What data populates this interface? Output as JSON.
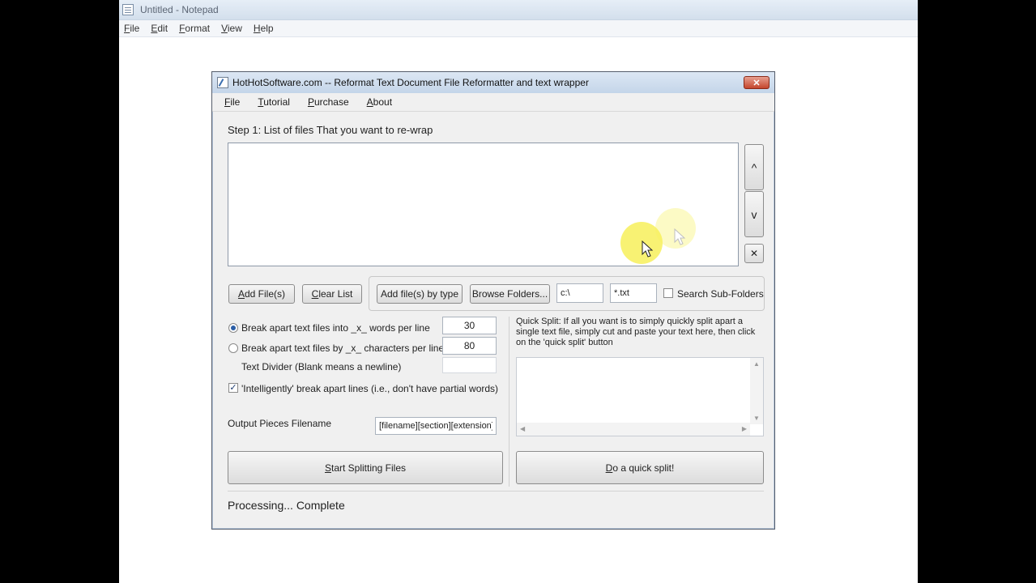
{
  "notepad": {
    "title": "Untitled - Notepad",
    "menu": [
      "File",
      "Edit",
      "Format",
      "View",
      "Help"
    ]
  },
  "dialog": {
    "title": "HotHotSoftware.com -- Reformat Text Document File Reformatter and text wrapper",
    "close_label": "✕",
    "menu": [
      "File",
      "Tutorial",
      "Purchase",
      "About"
    ],
    "step1_label": "Step 1: List of files That you want to re-wrap",
    "move_up_label": "^",
    "move_down_label": "v",
    "remove_label": "✕",
    "add_files_label": "Add File(s)",
    "clear_list_label": "Clear List",
    "add_by_type_label": "Add file(s) by type",
    "browse_folders_label": "Browse Folders...",
    "folder_value": "c:\\",
    "file_type_value": "*.txt",
    "search_subfolders_label": "Search Sub-Folders",
    "search_subfolders_checked": false,
    "break_words_label": "Break apart text files into _x_ words per line",
    "break_words_value": "30",
    "break_words_selected": true,
    "break_chars_label": "Break apart text files by _x_ characters per line",
    "break_chars_value": "80",
    "break_chars_selected": false,
    "divider_label": "Text Divider (Blank means a newline)",
    "divider_value": "",
    "intelligent_label": "'Intelligently' break apart lines (i.e., don't have partial words)",
    "intelligent_checked": true,
    "output_label": "Output Pieces Filename",
    "output_value": "[filename][section][extension]",
    "quick_split_text": "Quick Split: If all you want is to simply quickly split apart a single text file, simply cut and paste your text here, then click on the 'quick split' button",
    "quick_split_content": "",
    "start_splitting_label": "Start Splitting Files",
    "quick_split_button_label": "Do a quick split!",
    "status_text": "Processing... Complete"
  },
  "colors": {
    "accent": "#2b5ea6",
    "cursor_highlight": "#f7f05a"
  }
}
